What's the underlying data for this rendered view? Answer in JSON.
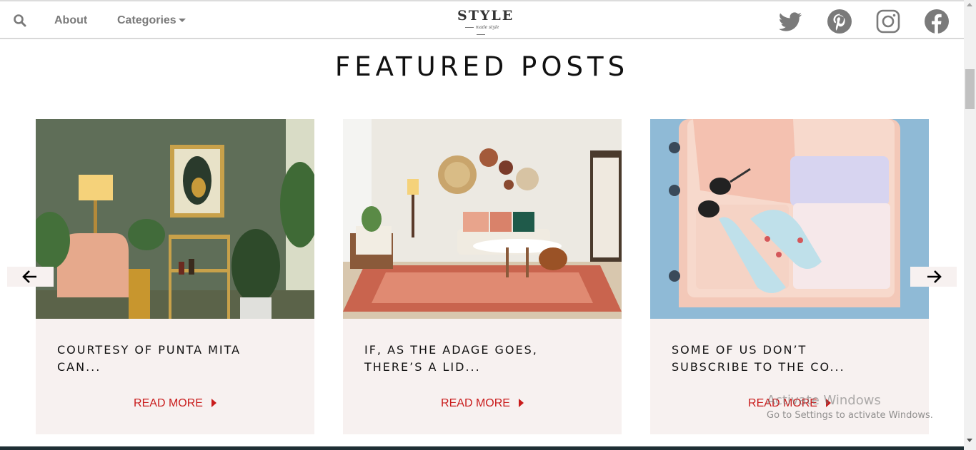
{
  "nav": {
    "about_label": "About",
    "categories_label": "Categories"
  },
  "logo": {
    "text": "STYLE",
    "tagline": "made style"
  },
  "social": [
    "twitter-icon",
    "pinterest-icon",
    "instagram-icon",
    "facebook-icon"
  ],
  "section_title": "FEATURED POSTS",
  "posts": [
    {
      "title": "COURTESY OF PUNTA MITA CAN...",
      "link_label": "READ MORE"
    },
    {
      "title": "IF, AS THE ADAGE GOES, THERE’S A LID...",
      "link_label": "READ MORE"
    },
    {
      "title": "SOME OF US DON’T SUBSCRIBE TO THE CO...",
      "link_label": "READ MORE"
    }
  ],
  "watermark": {
    "title": "Activate Windows",
    "subtitle": "Go to Settings to activate Windows."
  },
  "colors": {
    "accent_red": "#c91c1c",
    "card_bg": "#f7f1f0",
    "nav_gray": "#7a7a7a"
  }
}
